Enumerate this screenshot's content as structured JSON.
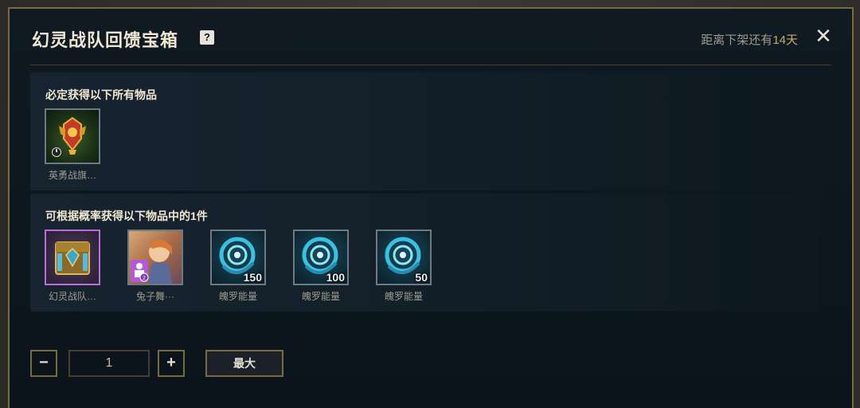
{
  "dialog": {
    "title": "幻灵战队回馈宝箱",
    "help_icon": "?",
    "countdown_prefix": "距离下架还有",
    "countdown_days": "14天",
    "close_icon": "✕"
  },
  "guaranteed": {
    "heading": "必定获得以下所有物品",
    "items": [
      {
        "label": "英勇战旗…"
      }
    ]
  },
  "random": {
    "heading": "可根据概率获得以下物品中的1件",
    "items": [
      {
        "label": "幻灵战队…"
      },
      {
        "label": "兔子舞···"
      },
      {
        "label": "魄罗能量",
        "qty": "150"
      },
      {
        "label": "魄罗能量",
        "qty": "100"
      },
      {
        "label": "魄罗能量",
        "qty": "50"
      }
    ]
  },
  "controls": {
    "minus": "−",
    "quantity": "1",
    "plus": "+",
    "max_label": "最大"
  },
  "colors": {
    "accent_gold": "#c8aa6e",
    "border_gold": "#7a6a44",
    "rare_purple": "#b96fd8"
  }
}
